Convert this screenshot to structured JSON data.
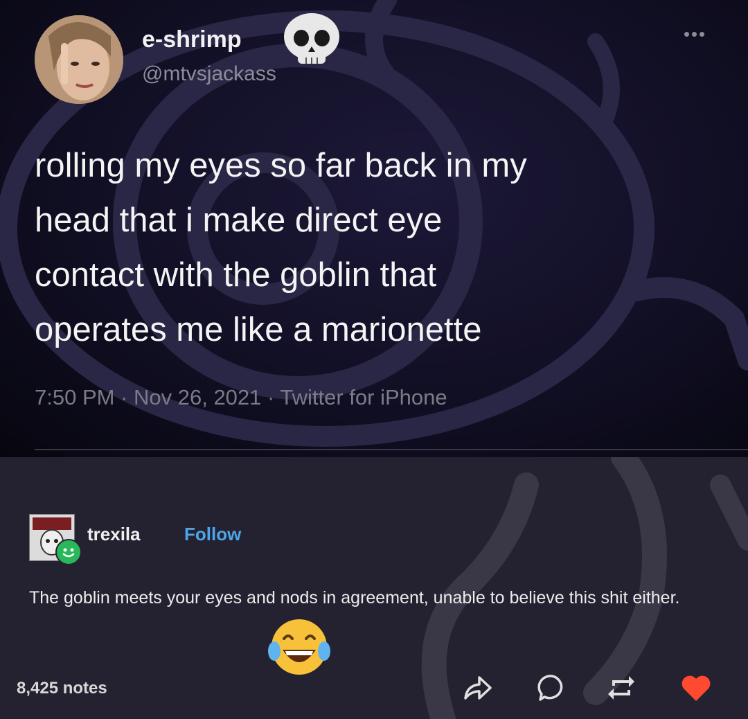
{
  "tweet": {
    "display_name": "e-shrimp",
    "handle": "@mtvsjackass",
    "text_lines": [
      "rolling my eyes so far back in my",
      "head that i make direct eye",
      "contact with the goblin that",
      "operates me like a marionette"
    ],
    "meta": "7:50 PM · Nov 26, 2021 · Twitter for iPhone",
    "name_emoji": "skull-icon"
  },
  "reply": {
    "username": "trexila",
    "follow_label": "Follow",
    "text": "The goblin meets your eyes and nods in agreement, unable to believe this shit either.",
    "emoji": "laughing-tears-icon",
    "notes": "8,425 notes"
  },
  "icons": {
    "share": "share-icon",
    "reply": "reply-icon",
    "reblog": "reblog-icon",
    "like": "heart-icon"
  },
  "colors": {
    "follow": "#4ea4e8",
    "heart": "#ff4930",
    "online_badge": "#28b85a"
  }
}
